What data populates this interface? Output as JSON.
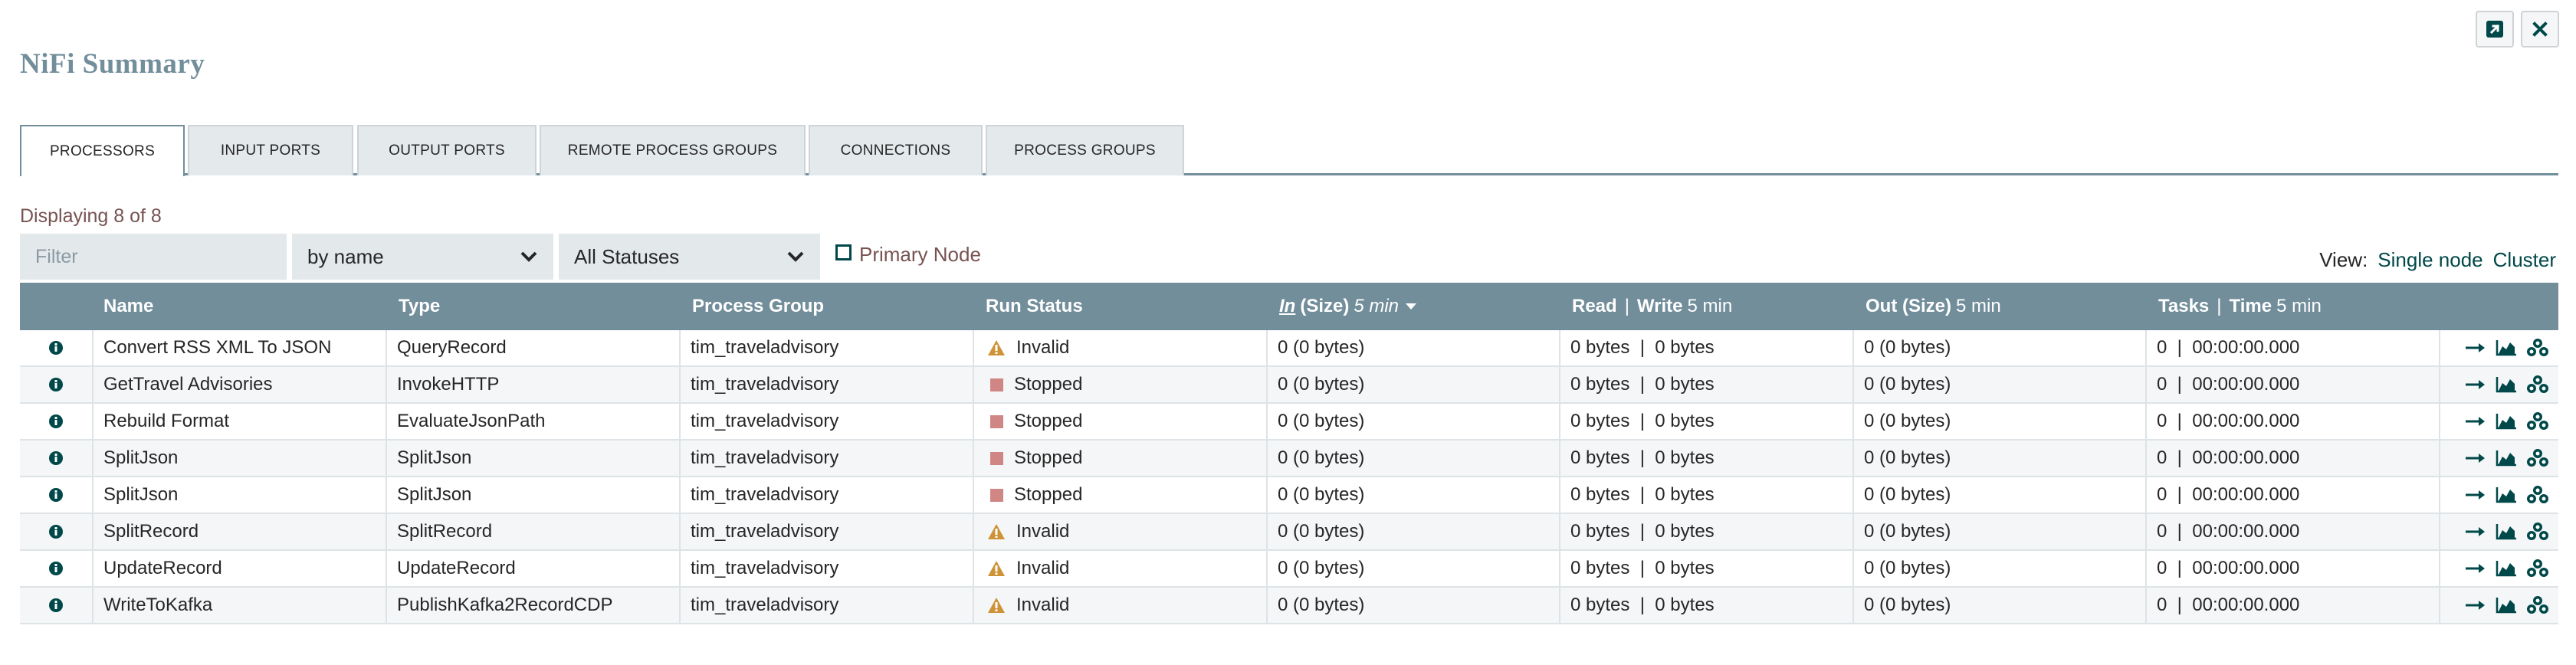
{
  "window": {
    "title": "NiFi Summary",
    "popout_icon": "external-link-icon",
    "close_icon": "close-icon"
  },
  "tabs": [
    {
      "label": "Processors",
      "active": true
    },
    {
      "label": "Input Ports",
      "active": false
    },
    {
      "label": "Output Ports",
      "active": false
    },
    {
      "label": "Remote Process Groups",
      "active": false
    },
    {
      "label": "Connections",
      "active": false
    },
    {
      "label": "Process Groups",
      "active": false
    }
  ],
  "toolbar": {
    "displaying": "Displaying 8 of 8",
    "filter_placeholder": "Filter",
    "filter_by": "by name",
    "status_filter": "All Statuses",
    "primary_node_label": "Primary Node",
    "view_label": "View:",
    "view_single": "Single node",
    "view_cluster": "Cluster"
  },
  "table": {
    "headers": {
      "name": "Name",
      "type": "Type",
      "group": "Process Group",
      "status": "Run Status",
      "in_label": "In",
      "in_size": "(Size)",
      "in_unit": "5 min",
      "read": "Read",
      "sep": "|",
      "write": "Write",
      "rw_unit": "5 min",
      "out": "Out (Size)",
      "out_unit": "5 min",
      "tasks": "Tasks",
      "time": "Time",
      "tasks_unit": "5 min"
    },
    "rows": [
      {
        "name": "Convert RSS XML To JSON",
        "type": "QueryRecord",
        "group": "tim_traveladvisory",
        "status": "Invalid",
        "in": "0 (0 bytes)",
        "rw": "0 bytes  |  0 bytes",
        "out": "0 (0 bytes)",
        "tasks": "0  |  00:00:00.000"
      },
      {
        "name": "GetTravel Advisories",
        "type": "InvokeHTTP",
        "group": "tim_traveladvisory",
        "status": "Stopped",
        "in": "0 (0 bytes)",
        "rw": "0 bytes  |  0 bytes",
        "out": "0 (0 bytes)",
        "tasks": "0  |  00:00:00.000"
      },
      {
        "name": "Rebuild Format",
        "type": "EvaluateJsonPath",
        "group": "tim_traveladvisory",
        "status": "Stopped",
        "in": "0 (0 bytes)",
        "rw": "0 bytes  |  0 bytes",
        "out": "0 (0 bytes)",
        "tasks": "0  |  00:00:00.000"
      },
      {
        "name": "SplitJson",
        "type": "SplitJson",
        "group": "tim_traveladvisory",
        "status": "Stopped",
        "in": "0 (0 bytes)",
        "rw": "0 bytes  |  0 bytes",
        "out": "0 (0 bytes)",
        "tasks": "0  |  00:00:00.000"
      },
      {
        "name": "SplitJson",
        "type": "SplitJson",
        "group": "tim_traveladvisory",
        "status": "Stopped",
        "in": "0 (0 bytes)",
        "rw": "0 bytes  |  0 bytes",
        "out": "0 (0 bytes)",
        "tasks": "0  |  00:00:00.000"
      },
      {
        "name": "SplitRecord",
        "type": "SplitRecord",
        "group": "tim_traveladvisory",
        "status": "Invalid",
        "in": "0 (0 bytes)",
        "rw": "0 bytes  |  0 bytes",
        "out": "0 (0 bytes)",
        "tasks": "0  |  00:00:00.000"
      },
      {
        "name": "UpdateRecord",
        "type": "UpdateRecord",
        "group": "tim_traveladvisory",
        "status": "Invalid",
        "in": "0 (0 bytes)",
        "rw": "0 bytes  |  0 bytes",
        "out": "0 (0 bytes)",
        "tasks": "0  |  00:00:00.000"
      },
      {
        "name": "WriteToKafka",
        "type": "PublishKafka2RecordCDP",
        "group": "tim_traveladvisory",
        "status": "Invalid",
        "in": "0 (0 bytes)",
        "rw": "0 bytes  |  0 bytes",
        "out": "0 (0 bytes)",
        "tasks": "0  |  00:00:00.000"
      }
    ],
    "row_icons": {
      "info": "info-icon",
      "status_invalid": "warning-icon",
      "status_stopped": "stopped-square-icon",
      "goto": "arrow-right-icon",
      "stats": "area-chart-icon",
      "cluster": "cluster-nodes-icon"
    }
  },
  "colors": {
    "header_bg": "#728e9b",
    "title": "#728e9b",
    "accent_text": "#775351",
    "link": "#004849",
    "active_link": "#1491c1",
    "invalid": "#ce9337",
    "stopped": "#d18686"
  }
}
